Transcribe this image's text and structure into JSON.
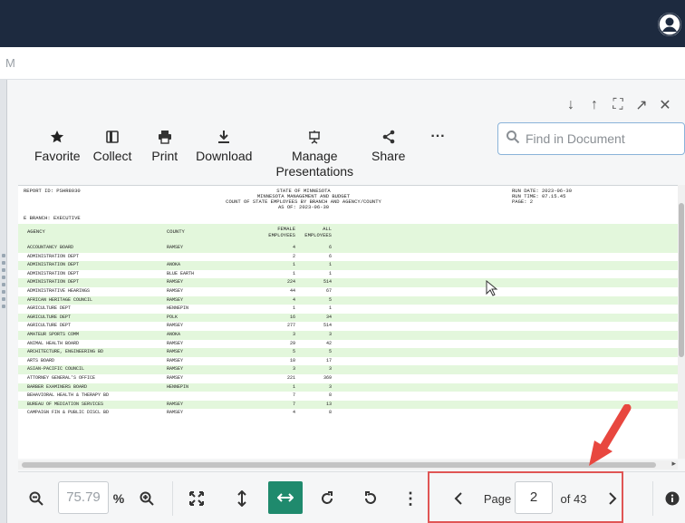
{
  "subbar": {
    "text": "M"
  },
  "window_tools": {
    "down": "↓",
    "up": "↑",
    "fullscreen": "⛶",
    "expand": "↗",
    "close": "✕"
  },
  "toolbar": {
    "favorite": "Favorite",
    "collect": "Collect",
    "print": "Print",
    "download": "Download",
    "manage": "Manage",
    "presentations": "Presentations",
    "share": "Share",
    "more": "···"
  },
  "search": {
    "placeholder": "Find in Document"
  },
  "document": {
    "header_left": "REPORT ID:  PSHR8030",
    "header_center": [
      "STATE OF MINNESOTA",
      "MINNESOTA MANAGEMENT AND BUDGET",
      "COUNT OF STATE EMPLOYEES BY BRANCH AND AGENCY/COUNTY",
      "AS OF: 2023-06-30"
    ],
    "header_right": [
      "RUN DATE:  2023-06-30",
      "RUN TIME:  07.15.45",
      "PAGE:  2"
    ],
    "branch": "E      BRANCH: EXECUTIVE",
    "col_agency": "AGENCY",
    "col_county": "COUNTY",
    "col_female": [
      "FEMALE",
      "EMPLOYEES"
    ],
    "col_all": [
      "ALL",
      "EMPLOYEES"
    ],
    "rows": [
      {
        "agency": "ACCOUNTANCY BOARD",
        "county": "RAMSEY",
        "female": "4",
        "all": "6"
      },
      {
        "agency": "ADMINISTRATION DEPT",
        "county": "",
        "female": "2",
        "all": "6"
      },
      {
        "agency": "ADMINISTRATION DEPT",
        "county": "ANOKA",
        "female": "1",
        "all": "1"
      },
      {
        "agency": "ADMINISTRATION DEPT",
        "county": "BLUE EARTH",
        "female": "1",
        "all": "1"
      },
      {
        "agency": "ADMINISTRATION DEPT",
        "county": "RAMSEY",
        "female": "224",
        "all": "514"
      },
      {
        "agency": "ADMINISTRATIVE HEARINGS",
        "county": "RAMSEY",
        "female": "44",
        "all": "67"
      },
      {
        "agency": "AFRICAN HERITAGE COUNCIL",
        "county": "RAMSEY",
        "female": "4",
        "all": "5"
      },
      {
        "agency": "AGRICULTURE DEPT",
        "county": "HENNEPIN",
        "female": "1",
        "all": "1"
      },
      {
        "agency": "AGRICULTURE DEPT",
        "county": "POLK",
        "female": "16",
        "all": "34"
      },
      {
        "agency": "AGRICULTURE DEPT",
        "county": "RAMSEY",
        "female": "277",
        "all": "514"
      },
      {
        "agency": "AMATEUR SPORTS COMM",
        "county": "ANOKA",
        "female": "3",
        "all": "3"
      },
      {
        "agency": "ANIMAL HEALTH BOARD",
        "county": "RAMSEY",
        "female": "29",
        "all": "42"
      },
      {
        "agency": "ARCHITECTURE, ENGINEERING BD",
        "county": "RAMSEY",
        "female": "5",
        "all": "5"
      },
      {
        "agency": "ARTS BOARD",
        "county": "RAMSEY",
        "female": "10",
        "all": "17"
      },
      {
        "agency": "ASIAN-PACIFIC COUNCIL",
        "county": "RAMSEY",
        "female": "3",
        "all": "3"
      },
      {
        "agency": "ATTORNEY GENERAL'S OFFICE",
        "county": "RAMSEY",
        "female": "221",
        "all": "369"
      },
      {
        "agency": "BARBER EXAMINERS BOARD",
        "county": "HENNEPIN",
        "female": "1",
        "all": "3"
      },
      {
        "agency": "BEHAVIORAL HEALTH & THERAPY BD",
        "county": "",
        "female": "7",
        "all": "8"
      },
      {
        "agency": "BUREAU OF MEDIATION SERVICES",
        "county": "RAMSEY",
        "female": "7",
        "all": "13"
      },
      {
        "agency": "CAMPAIGN FIN & PUBLIC DISCL BD",
        "county": "RAMSEY",
        "female": "4",
        "all": "8"
      }
    ]
  },
  "bottombar": {
    "zoom_value": "75.79",
    "percent": "%",
    "page_label": "Page",
    "page_value": "2",
    "page_total": "of 43"
  }
}
